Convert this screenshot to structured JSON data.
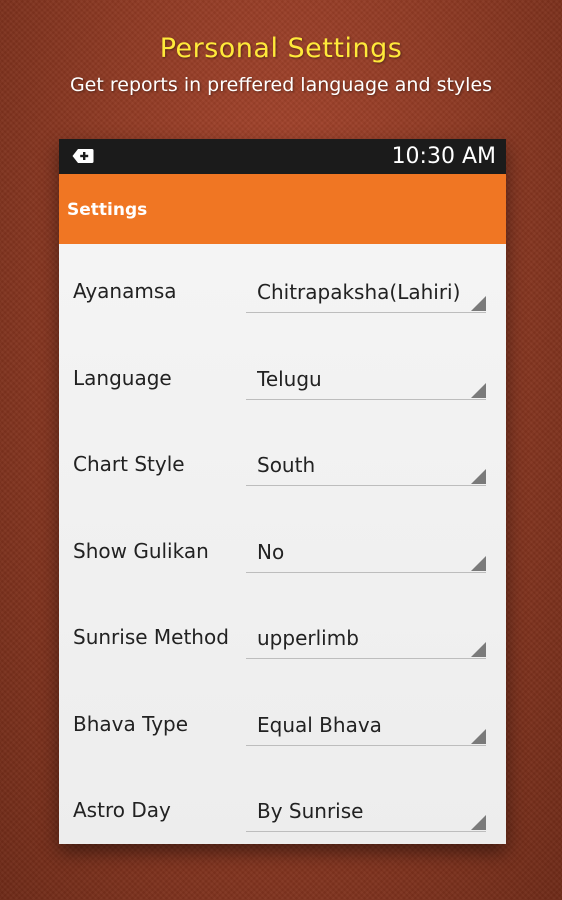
{
  "promo": {
    "title": "Personal Settings",
    "subtitle": "Get reports in preffered language and styles"
  },
  "statusbar": {
    "time": "10:30 AM",
    "notification_icon": "add-notification-icon"
  },
  "appbar": {
    "title": "Settings"
  },
  "colors": {
    "appbar": "#f07623",
    "headline": "#ffe93a",
    "statusbar": "#1b1b1b"
  },
  "settings": [
    {
      "label": "Ayanamsa",
      "value": "Chitrapaksha(Lahiri)"
    },
    {
      "label": "Language",
      "value": "Telugu"
    },
    {
      "label": "Chart Style",
      "value": "South"
    },
    {
      "label": "Show Gulikan",
      "value": "No"
    },
    {
      "label": "Sunrise Method",
      "value": "upperlimb"
    },
    {
      "label": "Bhava Type",
      "value": "Equal Bhava"
    },
    {
      "label": "Astro Day",
      "value": "By Sunrise"
    }
  ]
}
